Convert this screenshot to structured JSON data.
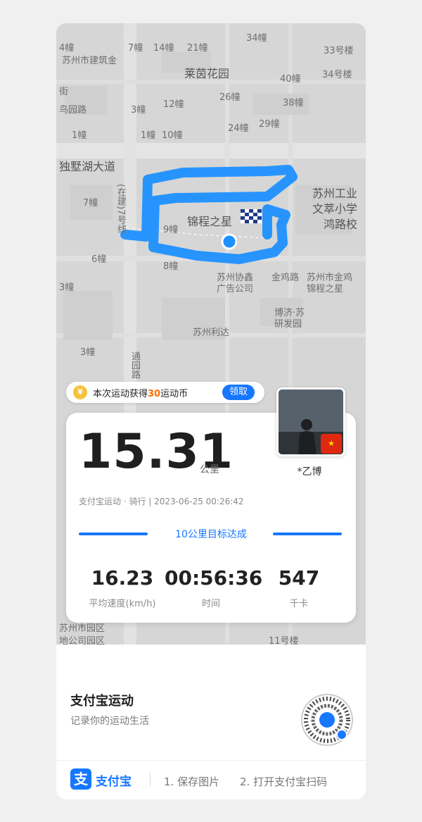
{
  "map": {
    "labels": [
      "34幢",
      "7幢",
      "14幢",
      "21幢",
      "33号楼",
      "苏州市建筑金",
      "莱茵花园",
      "40幢",
      "34号楼",
      "街",
      "鸟园路",
      "3幢",
      "12幢",
      "26幢",
      "38幢",
      "1幢",
      "1幢",
      "10幢",
      "24幢",
      "29幢",
      "独墅湖大道",
      "(在建)7号线",
      "苏州工业",
      "文萃小学",
      "鸿路校",
      "7幢",
      "锦程之星",
      "9幢",
      "6幢",
      "8幢",
      "苏州协鑫",
      "广告公司",
      "金鸡路",
      "苏州市金鸡",
      "锦程之星",
      "3幢",
      "博济·苏",
      "研发园",
      "苏州利达",
      "3幢",
      "通园路",
      "苏州市园区",
      "地公司园区",
      "11号楼",
      "4幢"
    ]
  },
  "coin_banner": {
    "prefix": "本次运动获得",
    "amount": "30",
    "suffix": "运动币",
    "claim_label": "领取"
  },
  "stats": {
    "distance": "15.31",
    "distance_unit": "公里",
    "meta": "支付宝运动 · 骑行 | 2023-06-25 00:26:42",
    "goal": "10公里目标达成",
    "speed_value": "16.23",
    "speed_label": "平均速度(km/h)",
    "time_value": "00:56:36",
    "time_label": "时间",
    "kcal_value": "547",
    "kcal_label": "千卡"
  },
  "user": {
    "name": "*乙博",
    "flag": "★"
  },
  "footer": {
    "title": "支付宝运动",
    "subtitle": "记录你的运动生活",
    "brand_icon": "支",
    "brand_name": "支付宝",
    "step1": "1. 保存图片",
    "step2": "2. 打开支付宝扫码"
  },
  "colors": {
    "accent": "#1677ff",
    "route": "#1e90ff",
    "coin_highlight": "#ff6a00"
  }
}
